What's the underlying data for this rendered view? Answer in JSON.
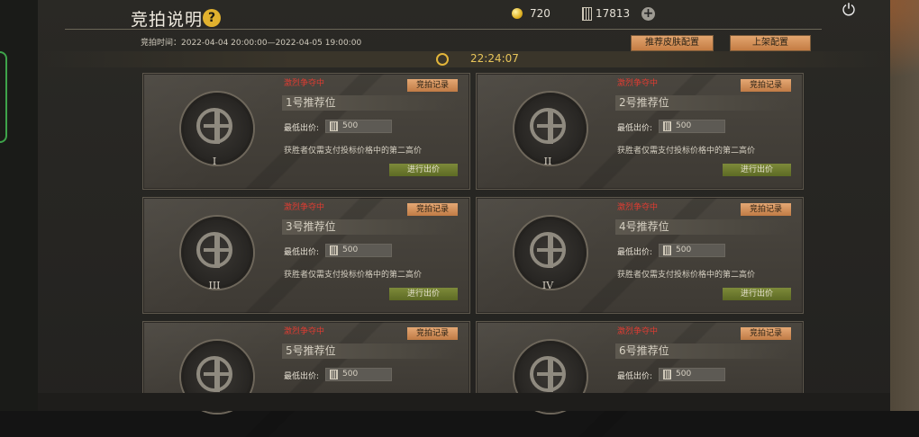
{
  "header": {
    "title": "竞拍说明",
    "help_glyph": "?",
    "gold": "720",
    "tickets": "17813",
    "plus_glyph": "+",
    "power_glyph": "⏻"
  },
  "auction": {
    "time_range": "竞拍时间：2022-04-04 20:00:00—2022-04-05 19:00:00",
    "countdown": "22:24:07"
  },
  "buttons": {
    "recommend_skin_config": "推荐皮肤配置",
    "listing_config": "上架配置"
  },
  "slots": [
    {
      "status": "激烈争夺中",
      "record": "竞拍记录",
      "name": "1号推荐位",
      "min_label": "最低出价:",
      "min_value": "500",
      "rule": "获胜者仅需支付投标价格中的第二高价",
      "bid": "进行出价",
      "roman": "I"
    },
    {
      "status": "激烈争夺中",
      "record": "竞拍记录",
      "name": "2号推荐位",
      "min_label": "最低出价:",
      "min_value": "500",
      "rule": "获胜者仅需支付投标价格中的第二高价",
      "bid": "进行出价",
      "roman": "II"
    },
    {
      "status": "激烈争夺中",
      "record": "竞拍记录",
      "name": "3号推荐位",
      "min_label": "最低出价:",
      "min_value": "500",
      "rule": "获胜者仅需支付投标价格中的第二高价",
      "bid": "进行出价",
      "roman": "III"
    },
    {
      "status": "激烈争夺中",
      "record": "竞拍记录",
      "name": "4号推荐位",
      "min_label": "最低出价:",
      "min_value": "500",
      "rule": "获胜者仅需支付投标价格中的第二高价",
      "bid": "进行出价",
      "roman": "IV"
    },
    {
      "status": "激烈争夺中",
      "record": "竞拍记录",
      "name": "5号推荐位",
      "min_label": "最低出价:",
      "min_value": "500"
    },
    {
      "status": "激烈争夺中",
      "record": "竞拍记录",
      "name": "6号推荐位",
      "min_label": "最低出价:",
      "min_value": "500"
    }
  ],
  "colors": {
    "status_red": "#e03c32",
    "accent_gold": "#e1b12e",
    "button_orange": "#d89059",
    "button_green": "#6f7c30"
  }
}
